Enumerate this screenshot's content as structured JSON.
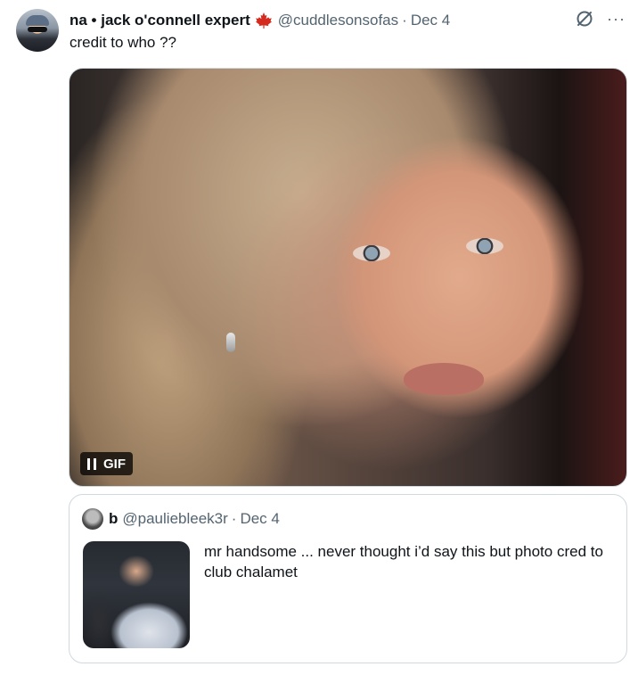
{
  "tweet": {
    "display_name": "na • jack o'connell expert",
    "flag_icon": "maple-leaf-icon",
    "handle": "@cuddlesonsofas",
    "separator": "·",
    "date": "Dec 4",
    "text": "credit to who ??",
    "more_label": "···",
    "media": {
      "badge_label": "GIF"
    }
  },
  "quote": {
    "display_name": "b",
    "handle": "@pauliebleek3r",
    "separator": "·",
    "date": "Dec 4",
    "text": "mr handsome ... never thought i’d say this but photo cred to club chalamet"
  },
  "colors": {
    "text": "#0f1419",
    "muted": "#536471",
    "border": "#cfd9de",
    "flag": "#d52b1e"
  }
}
